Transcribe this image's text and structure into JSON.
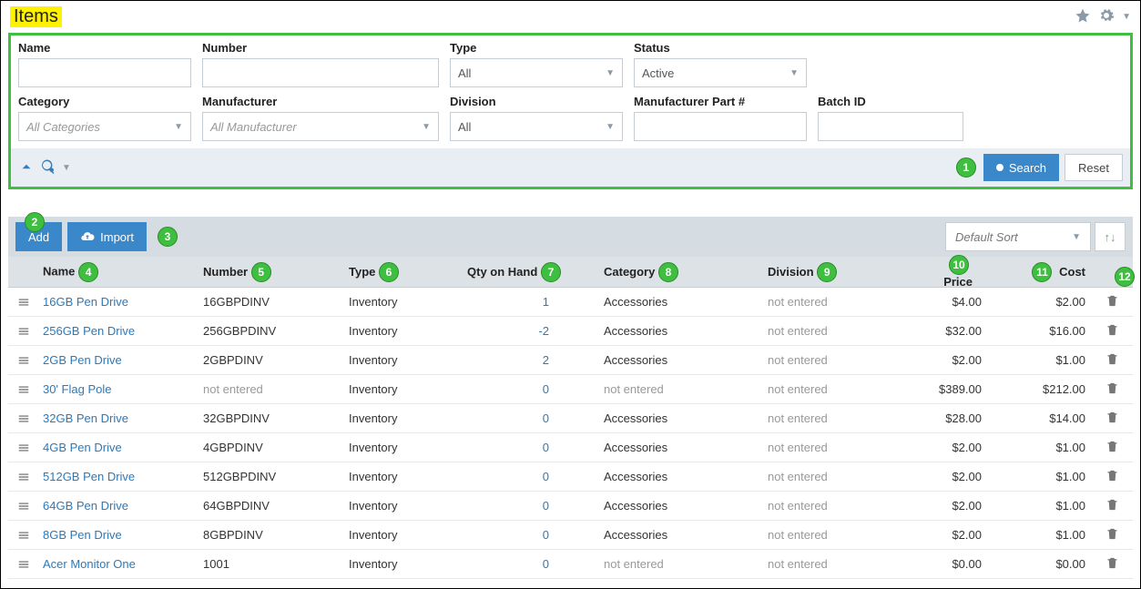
{
  "page": {
    "title": "Items"
  },
  "search": {
    "fields": {
      "name": {
        "label": "Name",
        "value": ""
      },
      "number": {
        "label": "Number",
        "value": ""
      },
      "type": {
        "label": "Type",
        "value": "All"
      },
      "status": {
        "label": "Status",
        "value": "Active"
      },
      "category": {
        "label": "Category",
        "placeholder": "All Categories"
      },
      "manufacturer": {
        "label": "Manufacturer",
        "placeholder": "All Manufacturer"
      },
      "division": {
        "label": "Division",
        "value": "All"
      },
      "mfr_part": {
        "label": "Manufacturer Part #",
        "value": ""
      },
      "batch_id": {
        "label": "Batch ID",
        "value": ""
      }
    },
    "buttons": {
      "search": "Search",
      "reset": "Reset"
    }
  },
  "toolbar": {
    "add": "Add",
    "import": "Import",
    "sort": "Default Sort"
  },
  "columns": {
    "name": "Name",
    "number": "Number",
    "type": "Type",
    "qty": "Qty on Hand",
    "category": "Category",
    "division": "Division",
    "price": "Price",
    "cost": "Cost"
  },
  "rows": [
    {
      "name": "16GB Pen Drive",
      "number": "16GBPDINV",
      "type": "Inventory",
      "qty": "1",
      "category": "Accessories",
      "division": "not entered",
      "price": "$4.00",
      "cost": "$2.00"
    },
    {
      "name": "256GB Pen Drive",
      "number": "256GBPDINV",
      "type": "Inventory",
      "qty": "-2",
      "category": "Accessories",
      "division": "not entered",
      "price": "$32.00",
      "cost": "$16.00"
    },
    {
      "name": "2GB Pen Drive",
      "number": "2GBPDINV",
      "type": "Inventory",
      "qty": "2",
      "category": "Accessories",
      "division": "not entered",
      "price": "$2.00",
      "cost": "$1.00"
    },
    {
      "name": "30' Flag Pole",
      "number": "not entered",
      "type": "Inventory",
      "qty": "0",
      "category": "not entered",
      "division": "not entered",
      "price": "$389.00",
      "cost": "$212.00"
    },
    {
      "name": "32GB Pen Drive",
      "number": "32GBPDINV",
      "type": "Inventory",
      "qty": "0",
      "category": "Accessories",
      "division": "not entered",
      "price": "$28.00",
      "cost": "$14.00"
    },
    {
      "name": "4GB Pen Drive",
      "number": "4GBPDINV",
      "type": "Inventory",
      "qty": "0",
      "category": "Accessories",
      "division": "not entered",
      "price": "$2.00",
      "cost": "$1.00"
    },
    {
      "name": "512GB Pen Drive",
      "number": "512GBPDINV",
      "type": "Inventory",
      "qty": "0",
      "category": "Accessories",
      "division": "not entered",
      "price": "$2.00",
      "cost": "$1.00"
    },
    {
      "name": "64GB Pen Drive",
      "number": "64GBPDINV",
      "type": "Inventory",
      "qty": "0",
      "category": "Accessories",
      "division": "not entered",
      "price": "$2.00",
      "cost": "$1.00"
    },
    {
      "name": "8GB Pen Drive",
      "number": "8GBPDINV",
      "type": "Inventory",
      "qty": "0",
      "category": "Accessories",
      "division": "not entered",
      "price": "$2.00",
      "cost": "$1.00"
    },
    {
      "name": "Acer Monitor One",
      "number": "1001",
      "type": "Inventory",
      "qty": "0",
      "category": "not entered",
      "division": "not entered",
      "price": "$0.00",
      "cost": "$0.00"
    }
  ],
  "badges": [
    "1",
    "2",
    "3",
    "4",
    "5",
    "6",
    "7",
    "8",
    "9",
    "10",
    "11",
    "12"
  ]
}
